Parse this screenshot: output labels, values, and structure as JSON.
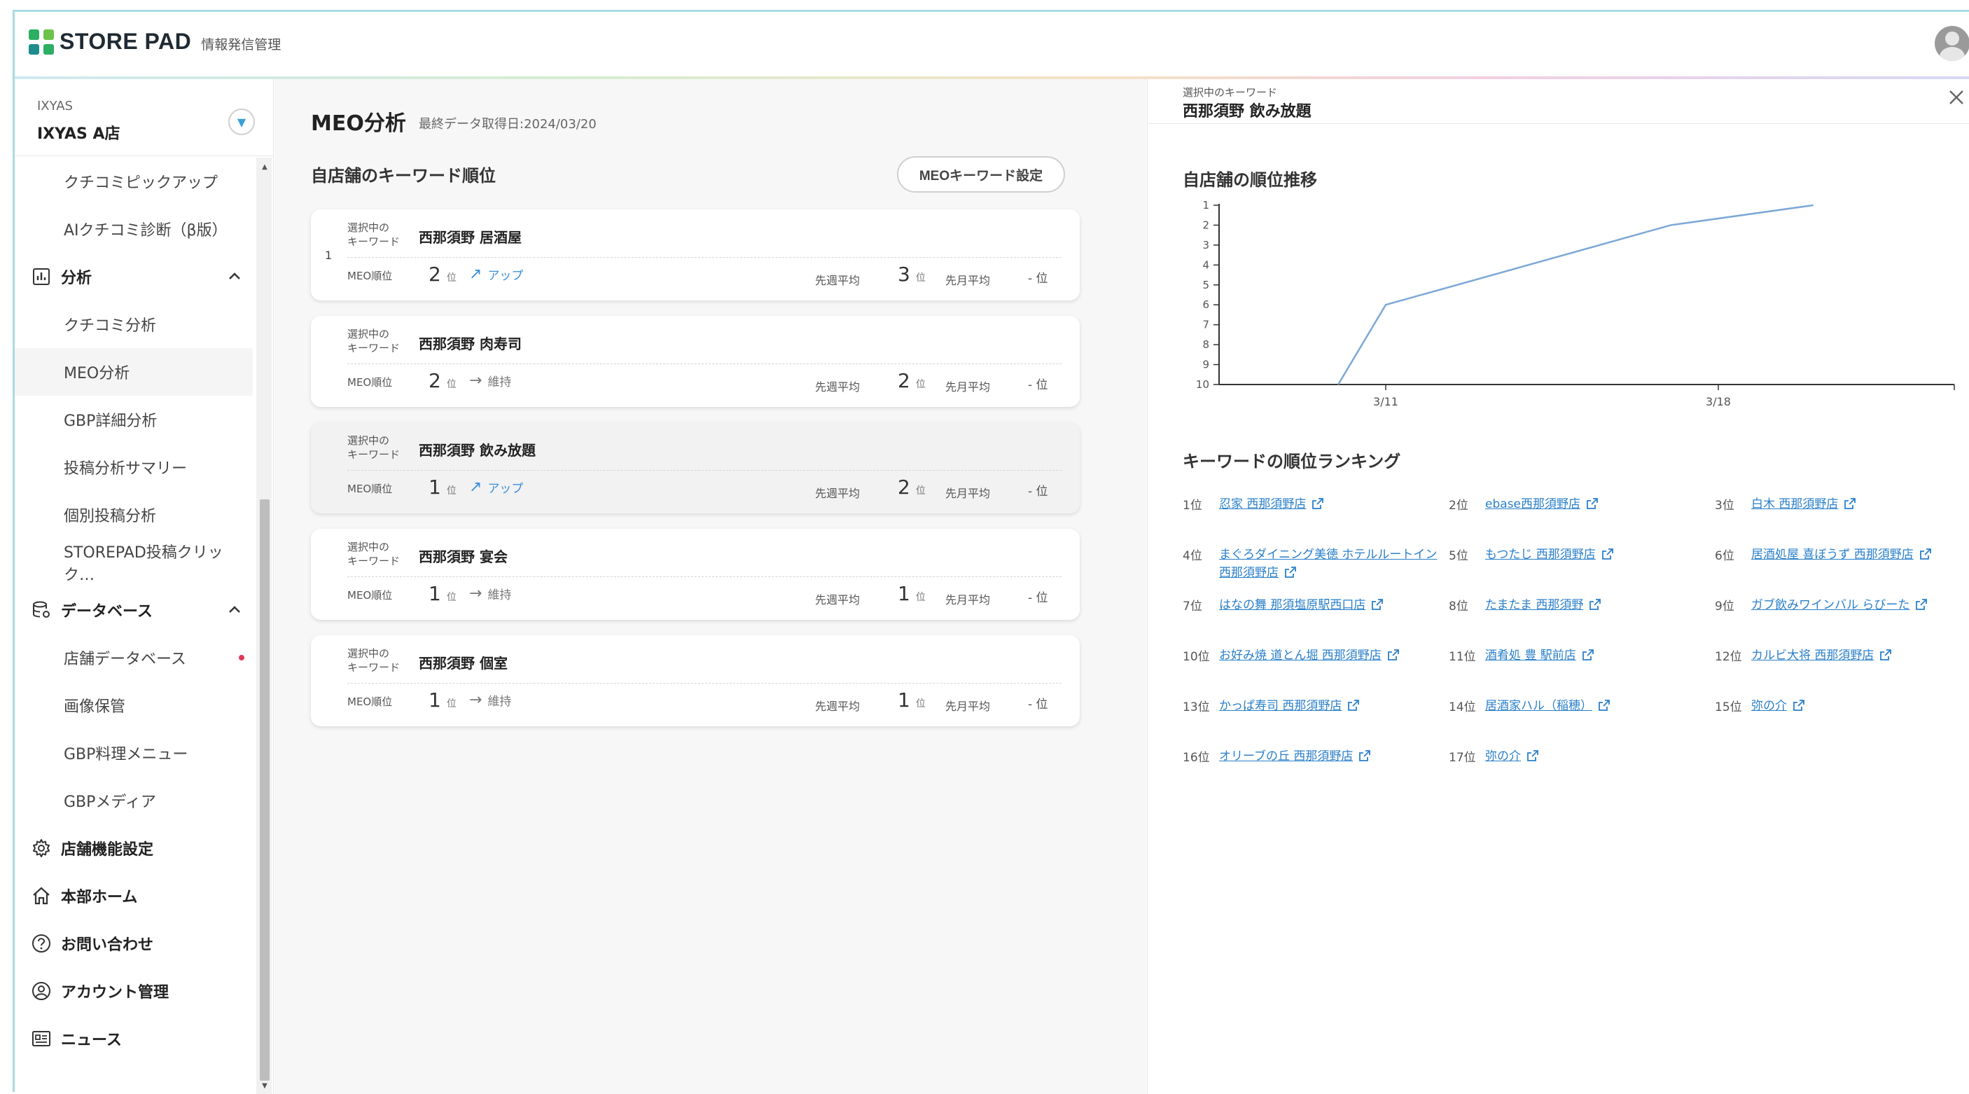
{
  "app": {
    "name": "STORE PAD",
    "subtitle": "情報発信管理"
  },
  "store": {
    "org": "IXYAS",
    "name": "IXYAS A店"
  },
  "sidebar": {
    "items": [
      {
        "label": "クチコミピックアップ",
        "type": "sub"
      },
      {
        "label": "AIクチコミ診断（β版）",
        "type": "sub"
      },
      {
        "label": "分析",
        "type": "top",
        "icon": "chart-icon"
      },
      {
        "label": "クチコミ分析",
        "type": "sub"
      },
      {
        "label": "MEO分析",
        "type": "sub",
        "active": true
      },
      {
        "label": "GBP詳細分析",
        "type": "sub"
      },
      {
        "label": "投稿分析サマリー",
        "type": "sub"
      },
      {
        "label": "個別投稿分析",
        "type": "sub"
      },
      {
        "label": "STOREPAD投稿クリック…",
        "type": "sub"
      },
      {
        "label": "データベース",
        "type": "top",
        "icon": "database-icon"
      },
      {
        "label": "店舗データベース",
        "type": "sub",
        "badge": "dot"
      },
      {
        "label": "画像保管",
        "type": "sub"
      },
      {
        "label": "GBP料理メニュー",
        "type": "sub"
      },
      {
        "label": "GBPメディア",
        "type": "sub"
      },
      {
        "label": "店舗機能設定",
        "type": "top",
        "icon": "gear-icon"
      },
      {
        "label": "本部ホーム",
        "type": "top",
        "icon": "home-icon"
      },
      {
        "label": "お問い合わせ",
        "type": "top",
        "icon": "question-icon"
      },
      {
        "label": "アカウント管理",
        "type": "top",
        "icon": "account-icon"
      },
      {
        "label": "ニュース",
        "type": "top",
        "icon": "news-icon"
      }
    ]
  },
  "main": {
    "title": "MEO分析",
    "last_fetched": "最終データ取得日:2024/03/20",
    "section_title": "自店舗のキーワード順位",
    "keyword_settings_button": "MEOキーワード設定",
    "labels": {
      "selected_keyword": "選択中の\nキーワード",
      "meo_rank": "MEO順位",
      "rank_unit": "位",
      "last_week_avg": "先週平均",
      "last_month_avg": "先月平均",
      "month_val": "- 位"
    },
    "cards": [
      {
        "index": "1",
        "keyword": "西那須野 居酒屋",
        "rank": "2",
        "trend": "アップ",
        "trend_type": "up",
        "last_week": "3",
        "selected": false
      },
      {
        "index": "",
        "keyword": "西那須野 肉寿司",
        "rank": "2",
        "trend": "維持",
        "trend_type": "keep",
        "last_week": "2",
        "selected": false
      },
      {
        "index": "",
        "keyword": "西那須野 飲み放題",
        "rank": "1",
        "trend": "アップ",
        "trend_type": "up",
        "last_week": "2",
        "selected": true
      },
      {
        "index": "",
        "keyword": "西那須野 宴会",
        "rank": "1",
        "trend": "維持",
        "trend_type": "keep",
        "last_week": "1",
        "selected": false
      },
      {
        "index": "",
        "keyword": "西那須野 個室",
        "rank": "1",
        "trend": "維持",
        "trend_type": "keep",
        "last_week": "1",
        "selected": false
      }
    ]
  },
  "detail": {
    "selected_label": "選択中のキーワード",
    "selected_keyword": "西那須野 飲み放題",
    "trend_title": "自店舗の順位推移",
    "ranking_title": "キーワードの順位ランキング",
    "ranking": [
      {
        "rank": "1位",
        "name": "忍家 西那須野店"
      },
      {
        "rank": "2位",
        "name": "ebase西那須野店"
      },
      {
        "rank": "3位",
        "name": "白木 西那須野店"
      },
      {
        "rank": "4位",
        "name": "まぐろダイニング美徳 ホテルルートイン西那須野店"
      },
      {
        "rank": "5位",
        "name": "もつたじ 西那須野店"
      },
      {
        "rank": "6位",
        "name": "居酒処屋 喜ぼうず 西那須野店"
      },
      {
        "rank": "7位",
        "name": "はなの舞 那須塩原駅西口店"
      },
      {
        "rank": "8位",
        "name": "たまたま 西那須野"
      },
      {
        "rank": "9位",
        "name": "ガブ飲みワインバル らびーた"
      },
      {
        "rank": "10位",
        "name": "お好み焼 道とん堀 西那須野店"
      },
      {
        "rank": "11位",
        "name": "酒肴処 豊 駅前店"
      },
      {
        "rank": "12位",
        "name": "カルビ大将 西那須野店"
      },
      {
        "rank": "13位",
        "name": "かっぱ寿司 西那須野店"
      },
      {
        "rank": "14位",
        "name": "居酒家ハル（稲穂）"
      },
      {
        "rank": "15位",
        "name": "弥の介"
      },
      {
        "rank": "16位",
        "name": "オリーブの丘 西那須野店"
      },
      {
        "rank": "17位",
        "name": "弥の介"
      }
    ]
  },
  "chart_data": {
    "type": "line",
    "title": "自店舗の順位推移",
    "x_ticks": [
      "3/11",
      "3/18"
    ],
    "y_ticks": [
      1,
      2,
      3,
      4,
      5,
      6,
      7,
      8,
      9,
      10
    ],
    "ylim": [
      10,
      1
    ],
    "y_inverted": true,
    "series": [
      {
        "points": [
          {
            "x": "3/10",
            "y": 10
          },
          {
            "x": "3/11",
            "y": 6
          },
          {
            "x": "3/17",
            "y": 2
          },
          {
            "x": "3/20",
            "y": 1
          }
        ]
      }
    ],
    "line_color": "#7da7d6"
  }
}
